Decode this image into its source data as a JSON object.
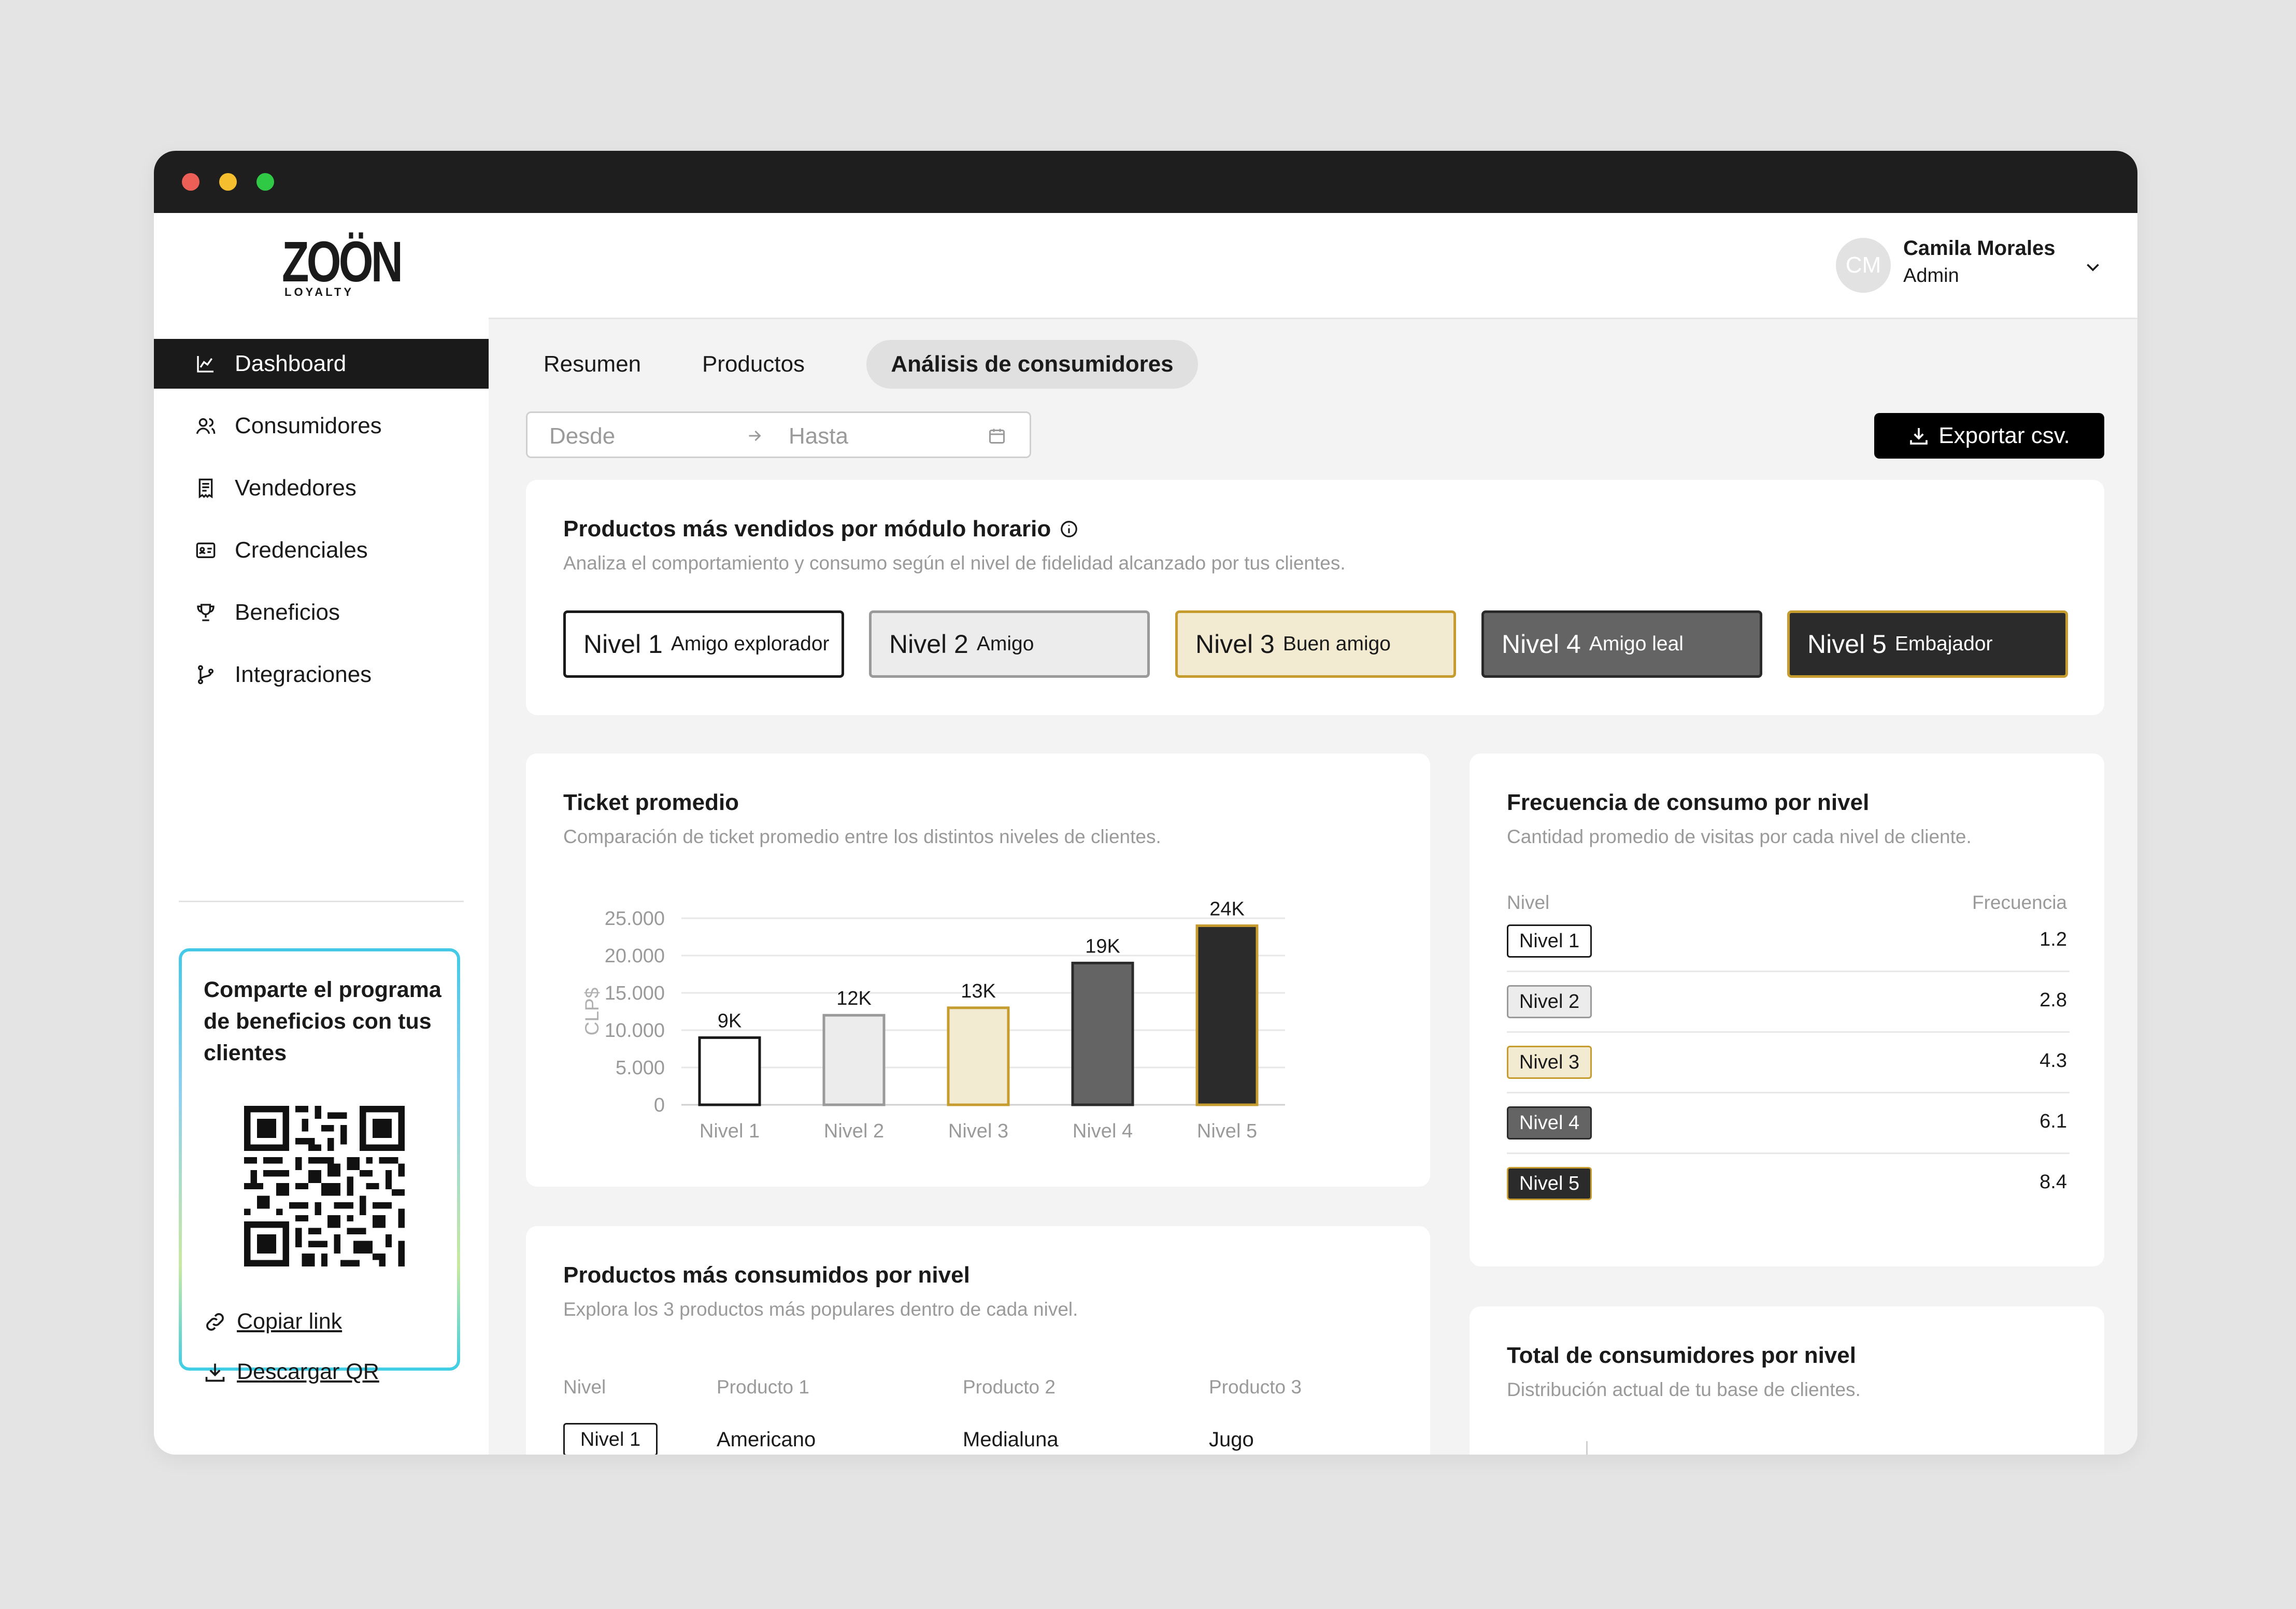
{
  "window": {
    "controls": [
      "close",
      "minimize",
      "maximize"
    ]
  },
  "brand": {
    "name": "ZOÖN",
    "tagline": "LOYALTY"
  },
  "sidebar": {
    "items": [
      {
        "label": "Dashboard",
        "icon": "chart-line-icon",
        "active": true
      },
      {
        "label": "Consumidores",
        "icon": "users-icon",
        "active": false
      },
      {
        "label": "Vendedores",
        "icon": "receipt-icon",
        "active": false
      },
      {
        "label": "Credenciales",
        "icon": "id-card-icon",
        "active": false
      },
      {
        "label": "Beneficios",
        "icon": "trophy-icon",
        "active": false
      },
      {
        "label": "Integraciones",
        "icon": "git-branch-icon",
        "active": false
      }
    ],
    "share": {
      "title": "Comparte el programa de beneficios con tus clientes",
      "copy_link": "Copiar link",
      "download_qr": "Descargar QR"
    }
  },
  "header": {
    "user": {
      "initials": "CM",
      "name": "Camila Morales",
      "role": "Admin"
    }
  },
  "tabs": [
    {
      "label": "Resumen",
      "active": false
    },
    {
      "label": "Productos",
      "active": false
    },
    {
      "label": "Análisis de consumidores",
      "active": true
    }
  ],
  "filters": {
    "from_placeholder": "Desde",
    "to_placeholder": "Hasta"
  },
  "export_label": "Exportar csv.",
  "levels_card": {
    "title": "Productos más vendidos por módulo horario",
    "subtitle": "Analiza el comportamiento y consumo según el nivel de fidelidad alcanzado por tus clientes.",
    "levels": [
      {
        "name": "Nivel 1",
        "desc": "Amigo explorador"
      },
      {
        "name": "Nivel 2",
        "desc": "Amigo"
      },
      {
        "name": "Nivel 3",
        "desc": "Buen amigo"
      },
      {
        "name": "Nivel 4",
        "desc": "Amigo leal"
      },
      {
        "name": "Nivel 5",
        "desc": "Embajador"
      }
    ]
  },
  "level_colors": [
    {
      "fill": "#ffffff",
      "border": "#1a1a1a",
      "text": "#1a1a1a"
    },
    {
      "fill": "#ececec",
      "border": "#9a9a9a",
      "text": "#1a1a1a"
    },
    {
      "fill": "#f3ead2",
      "border": "#c69c2e",
      "text": "#1a1a1a"
    },
    {
      "fill": "#646464",
      "border": "#2a2a2a",
      "text": "#ffffff"
    },
    {
      "fill": "#2b2b2b",
      "border": "#c69c2e",
      "text": "#ffffff"
    }
  ],
  "ticket_card": {
    "title": "Ticket promedio",
    "subtitle": "Comparación de ticket promedio entre los distintos niveles de clientes."
  },
  "chart_data": {
    "type": "bar",
    "categories": [
      "Nivel 1",
      "Nivel 2",
      "Nivel 3",
      "Nivel 4",
      "Nivel 5"
    ],
    "values": [
      9000,
      12000,
      13000,
      19000,
      24000
    ],
    "data_labels": [
      "9K",
      "12K",
      "13K",
      "19K",
      "24K"
    ],
    "ylabel": "CLP$",
    "ylim": [
      0,
      25000
    ],
    "yticks": [
      "0",
      "5.000",
      "10.000",
      "15.000",
      "20.000",
      "25.000"
    ],
    "grid": true
  },
  "frequency_card": {
    "title": "Frecuencia de consumo por nivel",
    "subtitle": "Cantidad promedio de visitas por cada nivel de cliente.",
    "col_level": "Nivel",
    "col_freq": "Frecuencia",
    "rows": [
      {
        "level": "Nivel 1",
        "value": "1.2"
      },
      {
        "level": "Nivel 2",
        "value": "2.8"
      },
      {
        "level": "Nivel 3",
        "value": "4.3"
      },
      {
        "level": "Nivel 4",
        "value": "6.1"
      },
      {
        "level": "Nivel 5",
        "value": "8.4"
      }
    ]
  },
  "products_card": {
    "title": "Productos más consumidos por nivel",
    "subtitle": "Explora los 3 productos más populares dentro de cada nivel.",
    "headers": [
      "Nivel",
      "Producto 1",
      "Producto 2",
      "Producto 3"
    ],
    "rows": [
      {
        "level": "Nivel 1",
        "p1": "Americano",
        "p2": "Medialuna",
        "p3": "Jugo"
      }
    ]
  },
  "totals_card": {
    "title": "Total de consumidores por nivel",
    "subtitle": "Distribución actual de tu base de clientes."
  }
}
